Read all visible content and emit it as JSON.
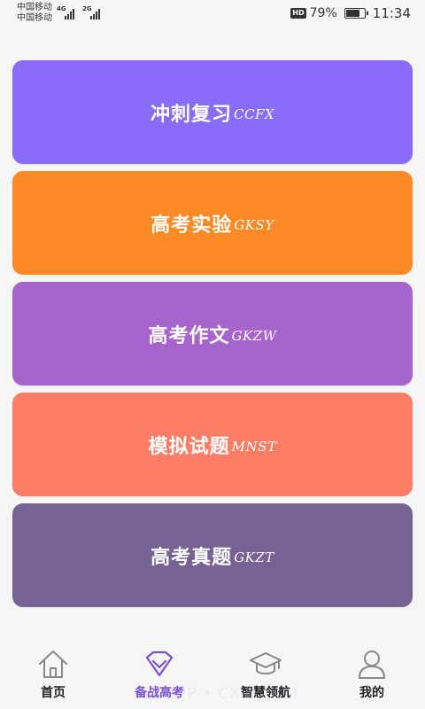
{
  "status": {
    "carriers": [
      "中国移动",
      "中国移动"
    ],
    "network1": "4G",
    "network2": "2G",
    "hd": "HD",
    "battery_percent": "79%",
    "battery_level": 0.79,
    "time": "11:34"
  },
  "cards": [
    {
      "title": "冲刺复习",
      "code": "CCFX",
      "color": "#8a6cfb"
    },
    {
      "title": "高考实验",
      "code": "GKSY",
      "color": "#fd8a24"
    },
    {
      "title": "高考作文",
      "code": "GKZW",
      "color": "#a764cc"
    },
    {
      "title": "模拟试题",
      "code": "MNST",
      "color": "#fd7d67"
    },
    {
      "title": "高考真题",
      "code": "GKZT",
      "color": "#776294"
    }
  ],
  "tabs": [
    {
      "label": "首页",
      "icon": "home-icon",
      "active": false
    },
    {
      "label": "备战高考",
      "icon": "heart-diamond-icon",
      "active": true
    },
    {
      "label": "智慧领航",
      "icon": "graduation-cap-icon",
      "active": false
    },
    {
      "label": "我的",
      "icon": "user-icon",
      "active": false
    }
  ],
  "watermark": "启 APP • CXW.COM",
  "colors": {
    "accent": "#7b4fd3",
    "icon_gray": "#888888"
  }
}
